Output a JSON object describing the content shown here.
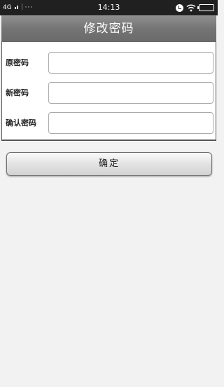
{
  "status_bar": {
    "network": "4G",
    "dots": "···",
    "time": "14:13",
    "icons": [
      "signal-icon",
      "alarm-icon",
      "wifi-icon",
      "battery-icon"
    ]
  },
  "header": {
    "title": "修改密码"
  },
  "form": {
    "fields": [
      {
        "label": "原密码",
        "value": "",
        "placeholder": ""
      },
      {
        "label": "新密码",
        "value": "",
        "placeholder": ""
      },
      {
        "label": "确认密码",
        "value": "",
        "placeholder": ""
      }
    ]
  },
  "actions": {
    "confirm_label": "确定"
  },
  "colors": {
    "status_bar": "#202020",
    "title_bar": "#7a7a7a",
    "background": "#f2f2f2"
  }
}
